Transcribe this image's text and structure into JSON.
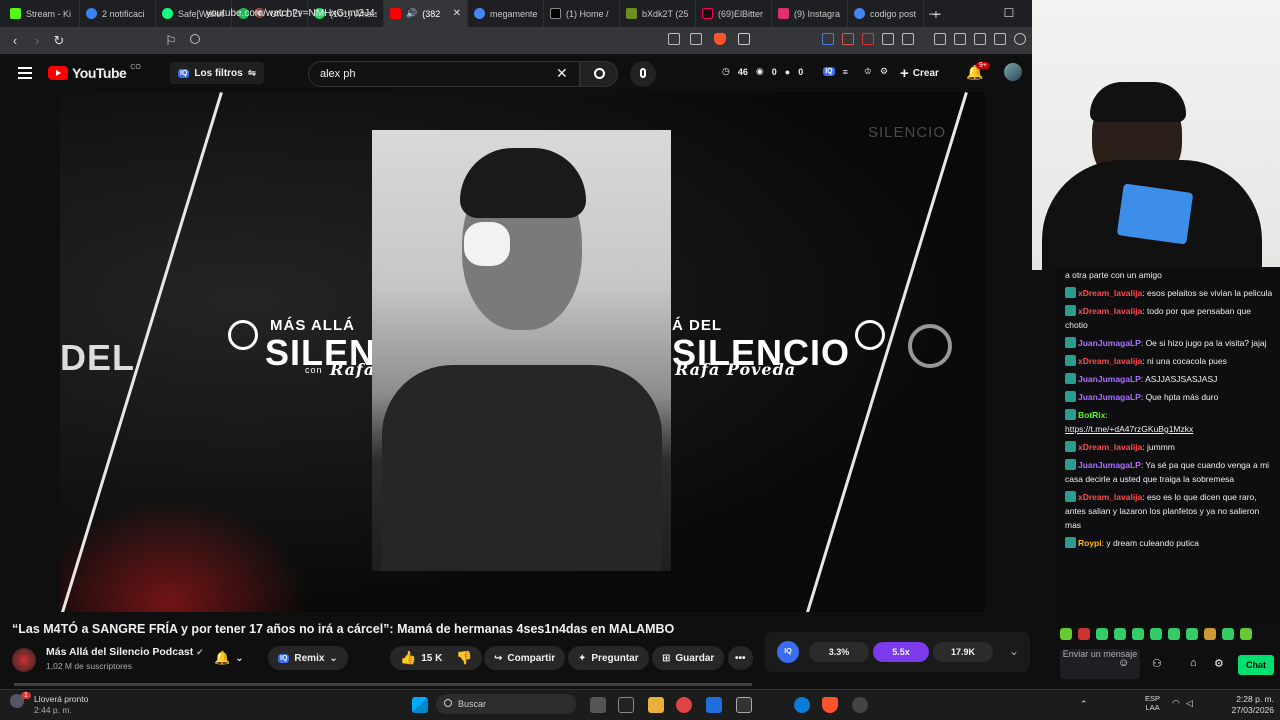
{
  "browser": {
    "tabs": [
      {
        "label": "Stream - Ki",
        "color": "#53fc18"
      },
      {
        "label": "2 notificaci",
        "color": "#3b82f6"
      },
      {
        "label": "Safe[Wallet",
        "color": "#12ff80"
      },
      {
        "label": "UN DES",
        "color": "#1db954"
      },
      {
        "label": "(101) Whats",
        "color": "#25d366"
      },
      {
        "label": "(382",
        "color": "#ff0000"
      },
      {
        "label": "megamente",
        "color": "#4285f4"
      },
      {
        "label": "(1) Home /",
        "color": "#ffffff"
      },
      {
        "label": "bXdk2T (25",
        "color": "#6b8e23"
      },
      {
        "label": "(69)ElBitter",
        "color": "#ff0050"
      },
      {
        "label": "(9) Instagra",
        "color": "#e1306c"
      },
      {
        "label": "codigo post",
        "color": "#4285f4"
      }
    ],
    "url": "youtube.com/watch?v=NMHxG-mt3J4"
  },
  "yt": {
    "logo": "YouTube",
    "country": "CO",
    "filters_label": "Los filtros",
    "iq_badge": "IQ",
    "search_value": "alex ph",
    "stats": [
      "46",
      "0",
      "0"
    ],
    "create_label": "Crear",
    "notif_count": "9+"
  },
  "video": {
    "brand_small": "MÁS ALLÁ",
    "brand_big": "SILENCIO",
    "brand_con": "con",
    "brand_signature": "Rafa Poveda",
    "brand_del": "Á DEL",
    "brand_left": "DEL",
    "watermark": "SILENCIO",
    "title": "“Las M4TÓ a SANGRE FRÍA y por tener 17 años no irá a cárcel”: Mamá de hermanas 4ses1n4das en MALAMBO",
    "channel_name": "Más Allá del Silencio Podcast",
    "subscribers": "1,02 M de suscriptores",
    "remix": "Remix",
    "likes": "15 K",
    "share": "Compartir",
    "ask": "Preguntar",
    "save": "Guardar",
    "iq_stats": [
      "3.3%",
      "5.5x",
      "17.9K"
    ],
    "progress": 0.0
  },
  "chat": {
    "messages": [
      {
        "user": "",
        "text": "a otra parte con un amigo",
        "color": "#efeff1"
      },
      {
        "user": "xDream_lavalija",
        "text": "esos pelaitos se vivian la pelicula",
        "color": "#ff4a4a"
      },
      {
        "user": "xDream_lavalija",
        "text": "todo por que pensaban que chotio",
        "color": "#ff4a4a"
      },
      {
        "user": "JuanJumagaLP",
        "text": "Oe si hizo jugo pa la visita? jajaj",
        "color": "#a970ff"
      },
      {
        "user": "xDream_lavalija",
        "text": "ni una cocacola pues",
        "color": "#ff4a4a"
      },
      {
        "user": "JuanJumagaLP",
        "text": "ASJJASJSASJASJ",
        "color": "#a970ff"
      },
      {
        "user": "JuanJumagaLP",
        "text": "Que hpta más duro",
        "color": "#a970ff"
      },
      {
        "user": "BotRix",
        "text": "https://t.me/+dA47rzGKuBg1Mzkx",
        "color": "#53fc18"
      },
      {
        "user": "xDream_lavalija",
        "text": "jummm",
        "color": "#ff4a4a"
      },
      {
        "user": "JuanJumagaLP",
        "text": "Ya sé pa que cuando venga a mi casa decirle a usted que traiga la sobremesa",
        "color": "#a970ff"
      },
      {
        "user": "xDream_lavalija",
        "text": "eso es lo que dicen que raro, antes salian y lazaron los planfetos y ya no salieron mas",
        "color": "#ff4a4a"
      },
      {
        "user": "Roypi",
        "text": "y dream culeando putica",
        "color": "#ffb800"
      }
    ],
    "input_placeholder": "Enviar un mensaje",
    "send_label": "Chat"
  },
  "taskbar": {
    "weather_title": "Lloverá pronto",
    "weather_time": "2:44 p. m.",
    "weather_badge": "1",
    "search_label": "Buscar",
    "lang": "ESP",
    "lang_sub": "LAA",
    "time": "2:28 p. m.",
    "date": "27/03/2026"
  }
}
